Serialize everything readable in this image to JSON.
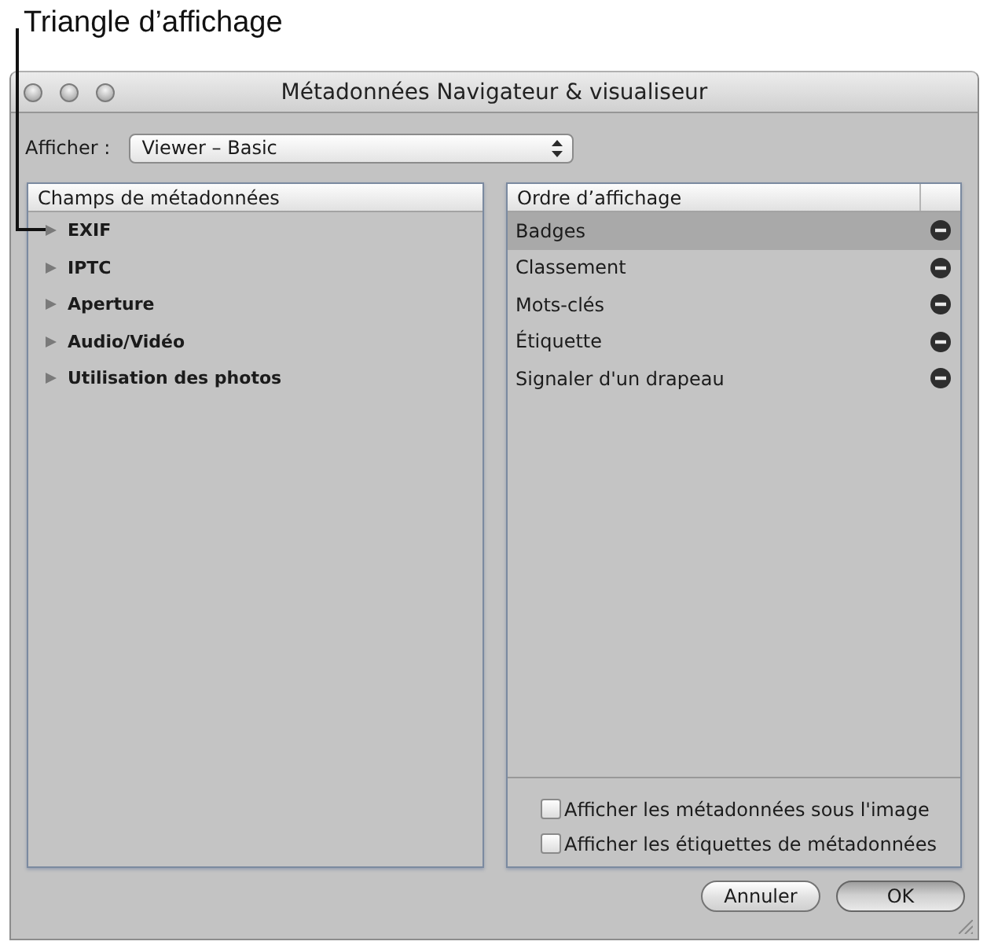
{
  "callout": {
    "label": "Triangle d’affichage"
  },
  "window": {
    "title": "Métadonnées Navigateur & visualiseur"
  },
  "view_selector": {
    "label": "Afficher :",
    "value": "Viewer – Basic"
  },
  "fields_panel": {
    "header": "Champs de métadonnées",
    "items": [
      {
        "label": "EXIF",
        "expanded": false
      },
      {
        "label": "IPTC",
        "expanded": false
      },
      {
        "label": "Aperture",
        "expanded": false
      },
      {
        "label": "Audio/Vidéo",
        "expanded": false
      },
      {
        "label": "Utilisation des photos",
        "expanded": false
      }
    ]
  },
  "order_panel": {
    "header": "Ordre d’affichage",
    "items": [
      {
        "label": "Badges",
        "selected": true
      },
      {
        "label": "Classement",
        "selected": false
      },
      {
        "label": "Mots-clés",
        "selected": false
      },
      {
        "label": "Étiquette",
        "selected": false
      },
      {
        "label": "Signaler d'un drapeau",
        "selected": false
      }
    ]
  },
  "options": [
    {
      "label": "Afficher les métadonnées sous l'image",
      "checked": false
    },
    {
      "label": "Afficher les étiquettes de métadonnées",
      "checked": false
    }
  ],
  "buttons": [
    {
      "label": "Annuler",
      "kind": "normal"
    },
    {
      "label": "OK",
      "kind": "default"
    }
  ]
}
